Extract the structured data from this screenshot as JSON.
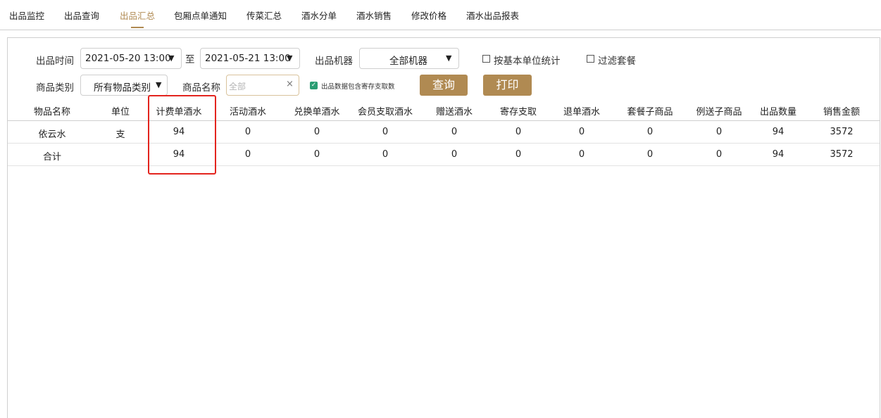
{
  "tabs": [
    {
      "label": "出品监控"
    },
    {
      "label": "出品查询"
    },
    {
      "label": "出品汇总"
    },
    {
      "label": "包厢点单通知"
    },
    {
      "label": "传菜汇总"
    },
    {
      "label": "酒水分单"
    },
    {
      "label": "酒水销售"
    },
    {
      "label": "修改价格"
    },
    {
      "label": "酒水出品报表"
    }
  ],
  "active_tab": "出品汇总",
  "filters": {
    "time_label": "出品时间",
    "start_time": "2021-05-20 13:00",
    "to_label": "至",
    "end_time": "2021-05-21 13:00",
    "machine_label": "出品机器",
    "machine_value": "全部机器",
    "base_unit_label": "按基本单位统计",
    "filter_set_label": "过滤套餐",
    "category_label": "商品类别",
    "category_value": "所有物品类别",
    "name_label": "商品名称",
    "name_placeholder": "全部",
    "clear_symbol": "×",
    "include_storage_label": "出品数据包含寄存支取数",
    "query_button": "查询",
    "print_button": "打印"
  },
  "table": {
    "columns": [
      "物品名称",
      "单位",
      "计费单酒水",
      "活动酒水",
      "兑换单酒水",
      "会员支取酒水",
      "赠送酒水",
      "寄存支取",
      "退单酒水",
      "套餐子商品",
      "例送子商品",
      "出品数量",
      "销售金额"
    ],
    "rows": [
      [
        "依云水",
        "支",
        "94",
        "0",
        "0",
        "0",
        "0",
        "0",
        "0",
        "0",
        "0",
        "94",
        "3572"
      ],
      [
        "合计",
        "",
        "94",
        "0",
        "0",
        "0",
        "0",
        "0",
        "0",
        "0",
        "0",
        "94",
        "3572"
      ]
    ]
  },
  "colors": {
    "accent": "#b08a52",
    "highlight": "#e3241e",
    "checkbox": "#2a9d73"
  }
}
